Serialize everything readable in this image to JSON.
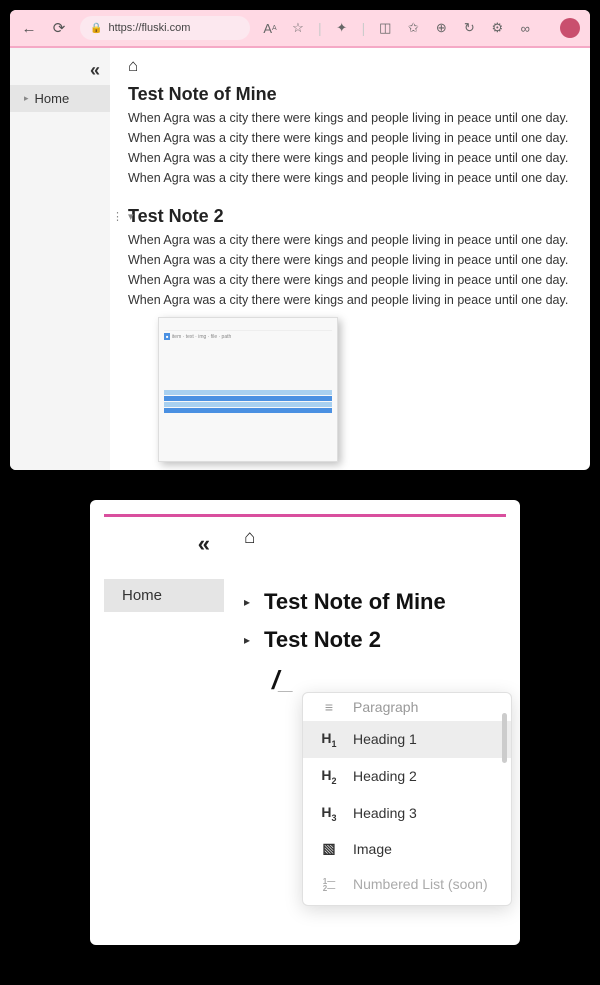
{
  "browser": {
    "url": "https://fluski.com",
    "icons": [
      "text-size",
      "star",
      "puzzle",
      "panel",
      "favorite",
      "collections",
      "sync",
      "profile",
      "more"
    ]
  },
  "sidebar": {
    "items": [
      {
        "label": "Home"
      }
    ]
  },
  "notes": [
    {
      "title": "Test Note of Mine",
      "paragraphs": [
        "When Agra was a city there were kings and people living in peace until one day.",
        "When Agra was a city there were kings and people living in peace until one day.",
        "When Agra was a city there were kings and people living in peace until one day.",
        "When Agra was a city there were kings and people living in peace until one day."
      ]
    },
    {
      "title": "Test Note 2",
      "paragraphs": [
        "When Agra was a city there were kings and people living in peace until one day.",
        "When Agra was a city there were kings and people living in peace until one day.",
        "When Agra was a city there were kings and people living in peace until one day.",
        "When Agra was a city there were kings and people living in peace until one day."
      ]
    }
  ],
  "outline": {
    "items": [
      "Test Note of Mine",
      "Test Note 2"
    ],
    "slash": "/"
  },
  "slashmenu": {
    "items": [
      {
        "icon": "≡",
        "label": "Paragraph",
        "cut": true
      },
      {
        "icon": "H₁",
        "label": "Heading 1",
        "selected": true
      },
      {
        "icon": "H₂",
        "label": "Heading 2"
      },
      {
        "icon": "H₃",
        "label": "Heading 3"
      },
      {
        "icon": "▧",
        "label": "Image"
      },
      {
        "icon": "1≡",
        "label": "Numbered List (soon)",
        "disabled": true
      }
    ]
  }
}
